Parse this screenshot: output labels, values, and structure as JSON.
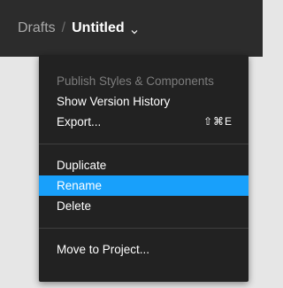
{
  "header": {
    "breadcrumb_parent": "Drafts",
    "breadcrumb_separator": "/",
    "file_name": "Untitled",
    "chevron_icon": "chevron-down-icon"
  },
  "menu": {
    "items": [
      {
        "label": "Publish Styles & Components",
        "state": "disabled"
      },
      {
        "label": "Show Version History",
        "state": "normal"
      },
      {
        "label": "Export...",
        "shortcut": "⇧⌘E",
        "state": "normal"
      },
      {
        "label": "Duplicate",
        "state": "normal"
      },
      {
        "label": "Rename",
        "state": "highlighted"
      },
      {
        "label": "Delete",
        "state": "normal"
      },
      {
        "label": "Move to Project...",
        "state": "normal"
      }
    ]
  },
  "colors": {
    "titlebar_bg": "#2c2c2c",
    "menu_bg": "#222222",
    "highlight": "#18a0fb",
    "disabled_text": "#7d7d7d"
  }
}
